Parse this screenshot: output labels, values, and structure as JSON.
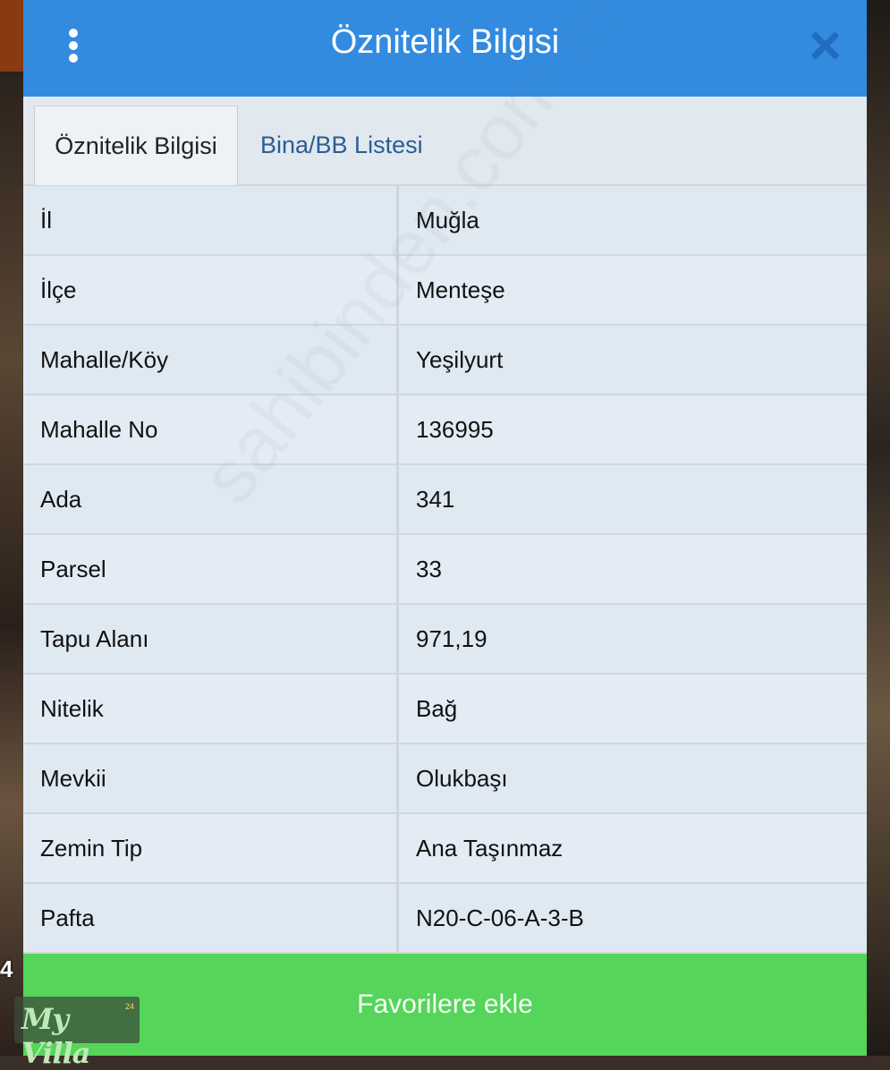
{
  "dialog": {
    "title": "Öznitelik Bilgisi",
    "close_icon": "close-icon",
    "menu_icon": "more-vertical-icon",
    "colors": {
      "header": "#338bdf",
      "button": "#55d55a"
    }
  },
  "tabs": [
    {
      "label": "Öznitelik Bilgisi",
      "active": true
    },
    {
      "label": "Bina/BB Listesi",
      "active": false
    }
  ],
  "rows": [
    {
      "key": "İl",
      "value": "Muğla"
    },
    {
      "key": "İlçe",
      "value": "Menteşe"
    },
    {
      "key": "Mahalle/Köy",
      "value": "Yeşilyurt"
    },
    {
      "key": "Mahalle No",
      "value": "136995"
    },
    {
      "key": "Ada",
      "value": "341"
    },
    {
      "key": "Parsel",
      "value": "33"
    },
    {
      "key": "Tapu Alanı",
      "value": "971,19"
    },
    {
      "key": "Nitelik",
      "value": "Bağ"
    },
    {
      "key": "Mevkii",
      "value": "Olukbaşı"
    },
    {
      "key": "Zemin Tip",
      "value": "Ana Taşınmaz"
    },
    {
      "key": "Pafta",
      "value": "N20-C-06-A-3-B"
    }
  ],
  "favorite_button": "Favorilere ekle",
  "watermark": "sahibinden.com emlakjet.com",
  "logo": {
    "text": "My Villa",
    "superscript": "24"
  },
  "map_label": "4"
}
